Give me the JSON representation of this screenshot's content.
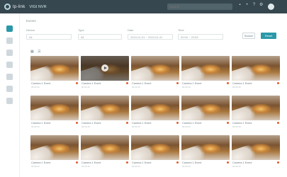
{
  "app": {
    "logo_text": "tp-link",
    "title": "VIGI NVR",
    "search_placeholder": "Search"
  },
  "breadcrumb": "Events",
  "filters": [
    {
      "label": "Device",
      "value": "All"
    },
    {
      "label": "Type",
      "value": "All"
    },
    {
      "label": "Date",
      "value": "2024-01-01 ~ 2024-01-31"
    },
    {
      "label": "Time",
      "value": "00:00 ~ 23:59"
    }
  ],
  "buttons": {
    "search": "Search",
    "reset": "Reset"
  },
  "toolbar": {
    "view_grid": "▦",
    "view_list": "☰"
  },
  "colors": {
    "topbar": "#37474f",
    "accent": "#2b98a8",
    "record_dot": "#e65a2a"
  },
  "thumbnails": [
    {
      "caption": "Camera 1 Event",
      "meta": "00:00:15"
    },
    {
      "caption": "Camera 1 Event",
      "meta": "00:00:15"
    },
    {
      "caption": "Camera 1 Event",
      "meta": "00:00:15"
    },
    {
      "caption": "Camera 1 Event",
      "meta": "00:00:15"
    },
    {
      "caption": "Camera 1 Event",
      "meta": "00:00:15"
    },
    {
      "caption": "Camera 1 Event",
      "meta": "00:00:15"
    },
    {
      "caption": "Camera 1 Event",
      "meta": "00:00:15"
    },
    {
      "caption": "Camera 1 Event",
      "meta": "00:00:15"
    },
    {
      "caption": "Camera 1 Event",
      "meta": "00:00:15"
    },
    {
      "caption": "Camera 1 Event",
      "meta": "00:00:15"
    },
    {
      "caption": "Camera 1 Event",
      "meta": "00:00:15"
    },
    {
      "caption": "Camera 1 Event",
      "meta": "00:00:15"
    },
    {
      "caption": "Camera 1 Event",
      "meta": "00:00:15"
    },
    {
      "caption": "Camera 1 Event",
      "meta": "00:00:15"
    },
    {
      "caption": "Camera 1 Event",
      "meta": "00:00:15"
    }
  ]
}
